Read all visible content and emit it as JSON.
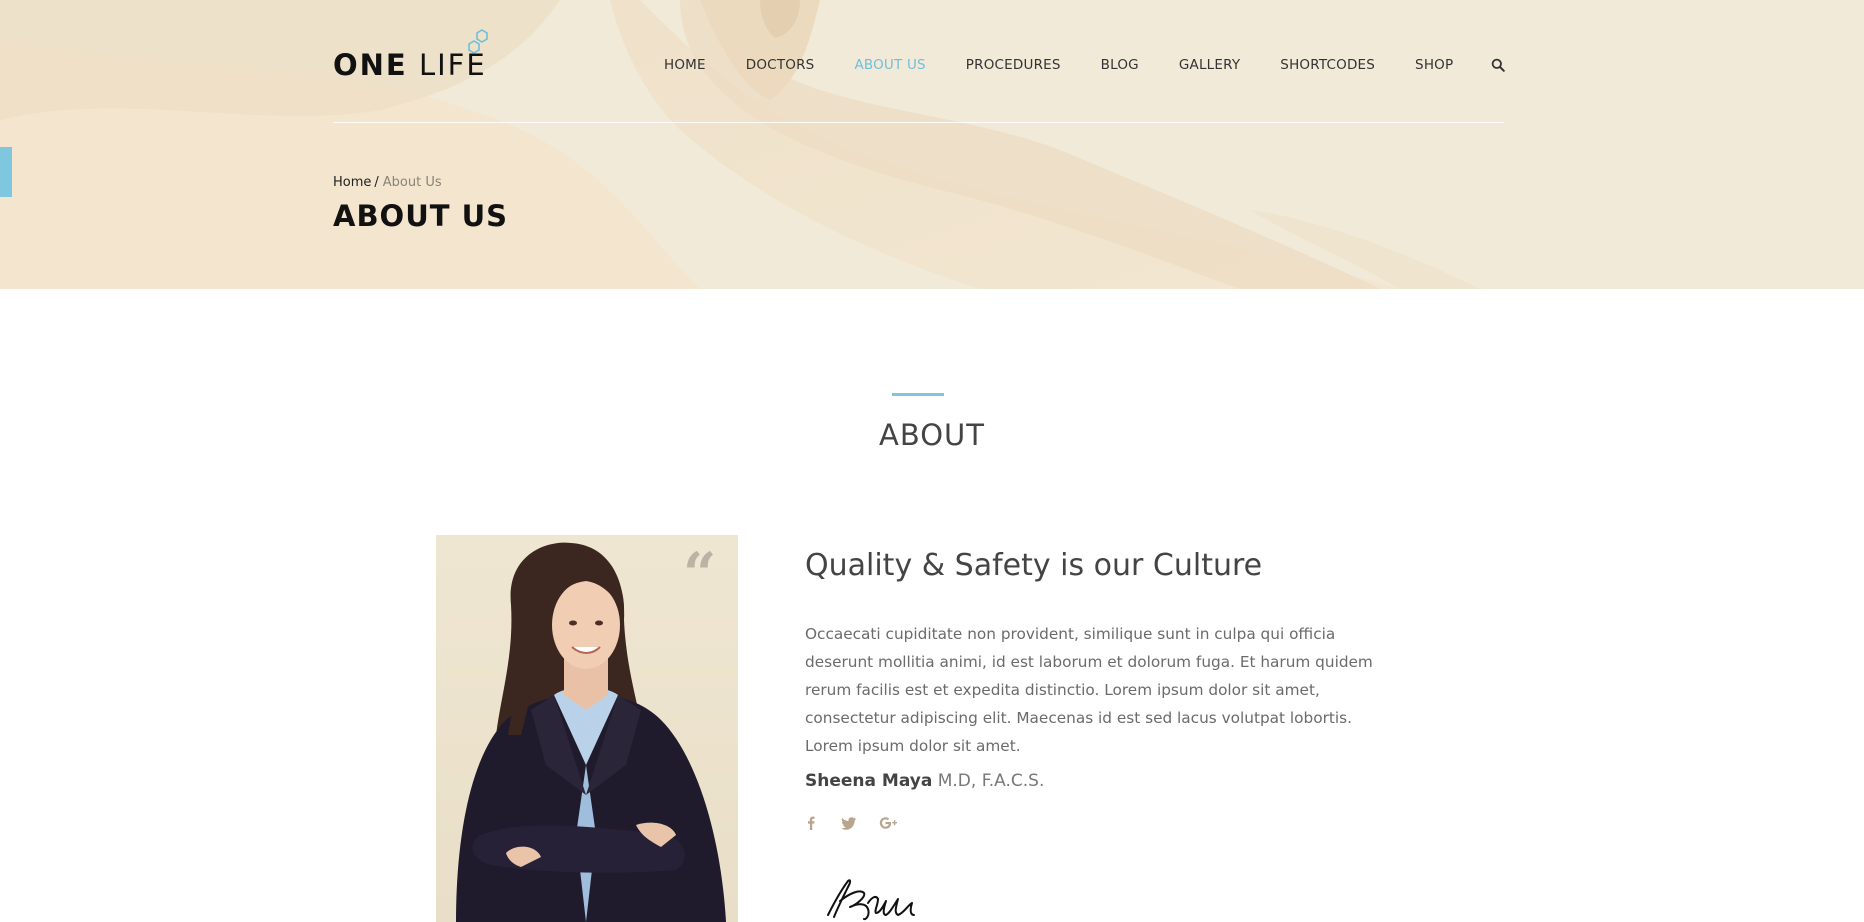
{
  "brand": {
    "name_bold": "ONE",
    "name_light": "LIFE"
  },
  "nav": {
    "items": [
      {
        "label": "HOME",
        "active": false
      },
      {
        "label": "DOCTORS",
        "active": false
      },
      {
        "label": "ABOUT US",
        "active": true
      },
      {
        "label": "PROCEDURES",
        "active": false
      },
      {
        "label": "BLOG",
        "active": false
      },
      {
        "label": "GALLERY",
        "active": false
      },
      {
        "label": "SHORTCODES",
        "active": false
      },
      {
        "label": "SHOP",
        "active": false
      }
    ],
    "search_icon": "search-icon"
  },
  "breadcrumb": {
    "home": "Home",
    "separator": "/",
    "current": "About Us"
  },
  "hero": {
    "title": "ABOUT US"
  },
  "about": {
    "section_title": "ABOUT",
    "quote_mark": "“",
    "heading": "Quality & Safety is our Culture",
    "body": "Occaecati cupiditate non provident, similique sunt in culpa qui officia deserunt mollitia animi, id est laborum et dolorum fuga. Et harum quidem rerum facilis est et expedita distinctio. Lorem ipsum dolor sit amet, consectetur adipiscing elit. Maecenas id est sed lacus volutpat lobortis. Lorem ipsum dolor sit amet.",
    "doctor_name": "Sheena Maya",
    "doctor_credentials": "M.D, F.A.C.S.",
    "socials": [
      "facebook-icon",
      "twitter-icon",
      "google-plus-icon"
    ]
  },
  "colors": {
    "accent": "#7ec7df",
    "hero_bg": "#f1ead8",
    "text_dark": "#111111",
    "text_body": "#6b6b6b"
  }
}
